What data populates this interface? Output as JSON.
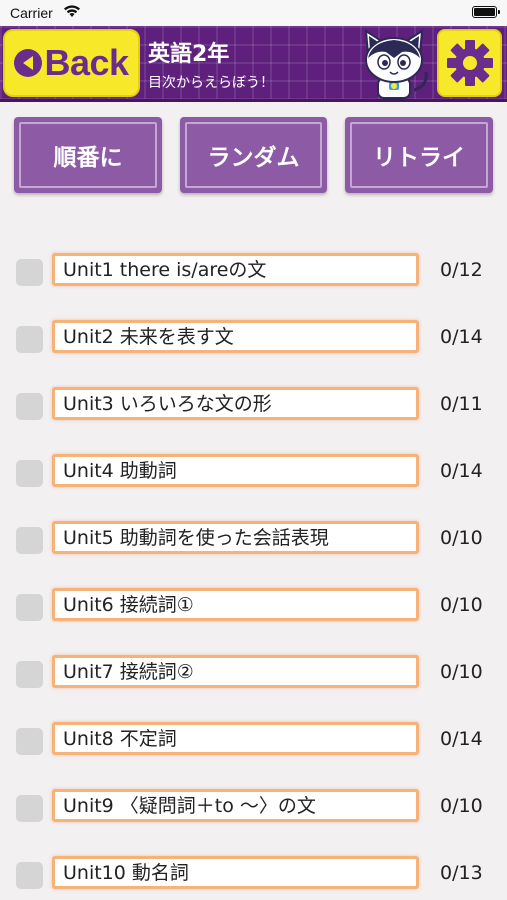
{
  "status_bar": {
    "carrier": "Carrier"
  },
  "header": {
    "back_label": "Back",
    "title": "英語2年",
    "subtitle": "目次からえらぼう！",
    "accent_color": "#5e1f7d",
    "button_color": "#f7e92a"
  },
  "modes": [
    {
      "label": "順番に"
    },
    {
      "label": "ランダム"
    },
    {
      "label": "リトライ"
    }
  ],
  "units": [
    {
      "title": "Unit1 there is/areの文",
      "score": "0/12"
    },
    {
      "title": "Unit2 未来を表す文",
      "score": "0/14"
    },
    {
      "title": "Unit3 いろいろな文の形",
      "score": "0/11"
    },
    {
      "title": "Unit4 助動詞",
      "score": "0/14"
    },
    {
      "title": "Unit5 助動詞を使った会話表現",
      "score": "0/10"
    },
    {
      "title": "Unit6 接続詞①",
      "score": "0/10"
    },
    {
      "title": "Unit7 接続詞②",
      "score": "0/10"
    },
    {
      "title": "Unit8 不定詞",
      "score": "0/14"
    },
    {
      "title": "Unit9 〈疑問詞＋to 〜〉の文",
      "score": "0/10"
    },
    {
      "title": "Unit10 動名詞",
      "score": "0/13"
    }
  ],
  "icons": {
    "wifi": "wifi-icon",
    "battery": "battery-icon",
    "back_arrow": "arrow-left-icon",
    "mascot": "cat-mascot-icon",
    "settings": "gear-icon"
  }
}
